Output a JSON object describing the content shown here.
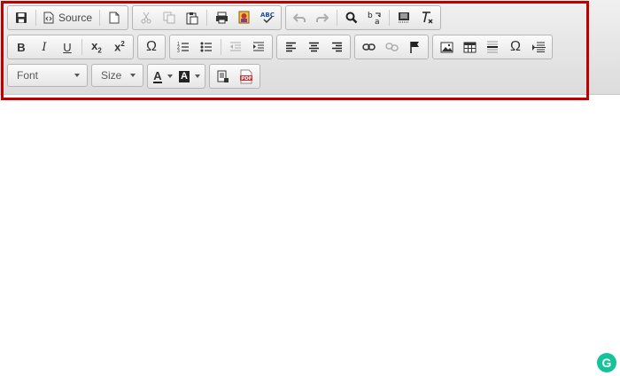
{
  "toolbar": {
    "source_label": "Source",
    "font_label": "Font",
    "size_label": "Size"
  },
  "icons": {
    "save": "save-icon",
    "source": "source-icon",
    "new_page": "new-page-icon",
    "cut": "cut-icon",
    "copy": "copy-icon",
    "paste": "paste-icon",
    "print": "print-icon",
    "paste_word": "paste-from-word-icon",
    "spellcheck": "spellcheck-icon",
    "undo": "undo-icon",
    "redo": "redo-icon",
    "find": "find-icon",
    "replace": "replace-icon",
    "select_all": "select-all-icon",
    "remove_format": "remove-format-icon",
    "bold": "bold-icon",
    "italic": "italic-icon",
    "underline": "underline-icon",
    "subscript": "subscript-icon",
    "superscript": "superscript-icon",
    "special_char": "omega-icon",
    "numbered_list": "numbered-list-icon",
    "bulleted_list": "bulleted-list-icon",
    "outdent": "outdent-icon",
    "indent": "indent-icon",
    "align_left": "align-left-icon",
    "align_center": "align-center-icon",
    "align_right": "align-right-icon",
    "link": "link-icon",
    "unlink": "unlink-icon",
    "anchor": "flag-icon",
    "image": "image-icon",
    "table": "table-icon",
    "hr": "horizontal-rule-icon",
    "special_char_2": "omega-icon",
    "page_break": "page-break-icon",
    "text_color": "text-color-icon",
    "bg_color": "background-color-icon",
    "templates": "templates-icon",
    "pdf": "pdf-icon"
  },
  "glyphs": {
    "omega": "Ω",
    "A": "A",
    "pdf": "PDF",
    "abc": "ABC"
  }
}
